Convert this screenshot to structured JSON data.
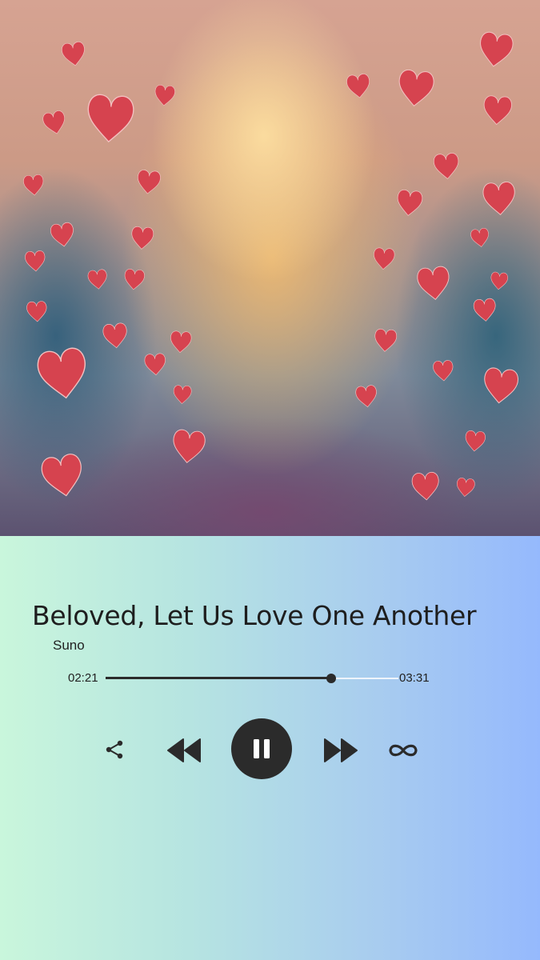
{
  "track": {
    "title": "Beloved, Let Us Love One Another",
    "artist": "Suno"
  },
  "progress": {
    "elapsed": "02:21",
    "total": "03:31",
    "fraction": 0.77
  },
  "controls": {
    "share_icon": "share-icon",
    "prev_icon": "rewind-icon",
    "play_state": "playing",
    "pause_icon": "pause-icon",
    "next_icon": "fast-forward-icon",
    "loop_icon": "infinity-loop-icon"
  },
  "colors": {
    "control_dark": "#2b2b2b",
    "heart_red": "#d6434f",
    "gradient_left": "#c9f6dc",
    "gradient_right": "#95b9fd"
  }
}
